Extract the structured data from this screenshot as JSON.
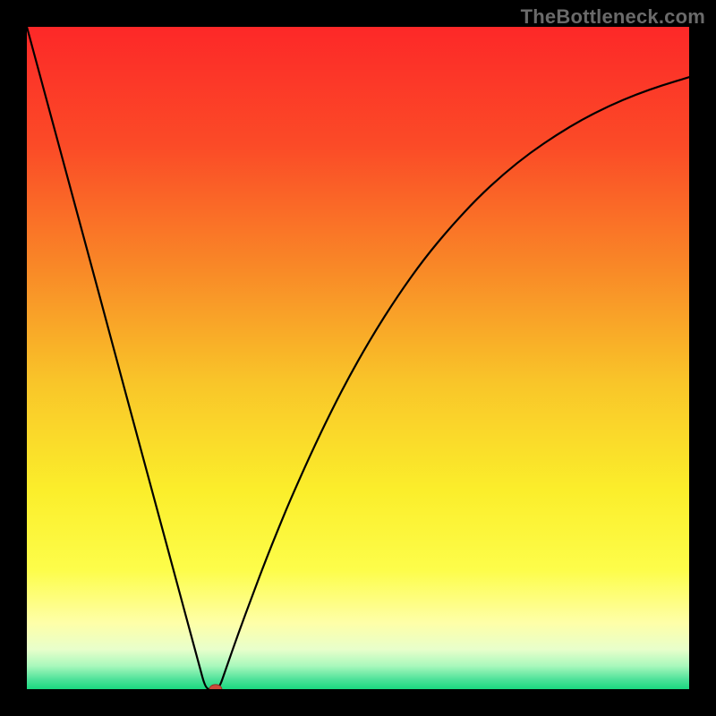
{
  "watermark": "TheBottleneck.com",
  "chart_data": {
    "type": "line",
    "title": "",
    "xlabel": "",
    "ylabel": "",
    "xlim": [
      0,
      100
    ],
    "ylim": [
      0,
      100
    ],
    "x": [
      0,
      2,
      4,
      6,
      8,
      10,
      12,
      14,
      16,
      18,
      20,
      22,
      24,
      25,
      26,
      27,
      28,
      29,
      30,
      32,
      34,
      36,
      38,
      40,
      44,
      48,
      52,
      56,
      60,
      64,
      68,
      72,
      76,
      80,
      84,
      88,
      92,
      96,
      100
    ],
    "values": [
      100,
      92.6,
      85.2,
      77.8,
      70.4,
      63.0,
      55.6,
      48.1,
      40.7,
      33.3,
      25.9,
      18.5,
      11.1,
      7.4,
      3.7,
      0.0,
      0.0,
      0.0,
      2.9,
      8.6,
      14.0,
      19.3,
      24.3,
      29.1,
      38.0,
      46.0,
      53.1,
      59.4,
      65.0,
      69.8,
      74.1,
      77.8,
      81.0,
      83.7,
      86.1,
      88.1,
      89.8,
      91.2,
      92.4
    ],
    "annotations": [
      {
        "type": "marker",
        "shape": "ellipse",
        "x": 28.5,
        "y": 0.0,
        "color": "#cc4a3b"
      }
    ],
    "background_gradient": {
      "stops": [
        {
          "offset": 0.0,
          "color": "#fd2828"
        },
        {
          "offset": 0.18,
          "color": "#fb4b27"
        },
        {
          "offset": 0.36,
          "color": "#f98727"
        },
        {
          "offset": 0.54,
          "color": "#f9c629"
        },
        {
          "offset": 0.7,
          "color": "#fbee2b"
        },
        {
          "offset": 0.82,
          "color": "#fdfd4a"
        },
        {
          "offset": 0.9,
          "color": "#feffa8"
        },
        {
          "offset": 0.94,
          "color": "#e8ffcb"
        },
        {
          "offset": 0.965,
          "color": "#a9f8bc"
        },
        {
          "offset": 0.985,
          "color": "#4fe29a"
        },
        {
          "offset": 1.0,
          "color": "#1ad87f"
        }
      ]
    }
  }
}
